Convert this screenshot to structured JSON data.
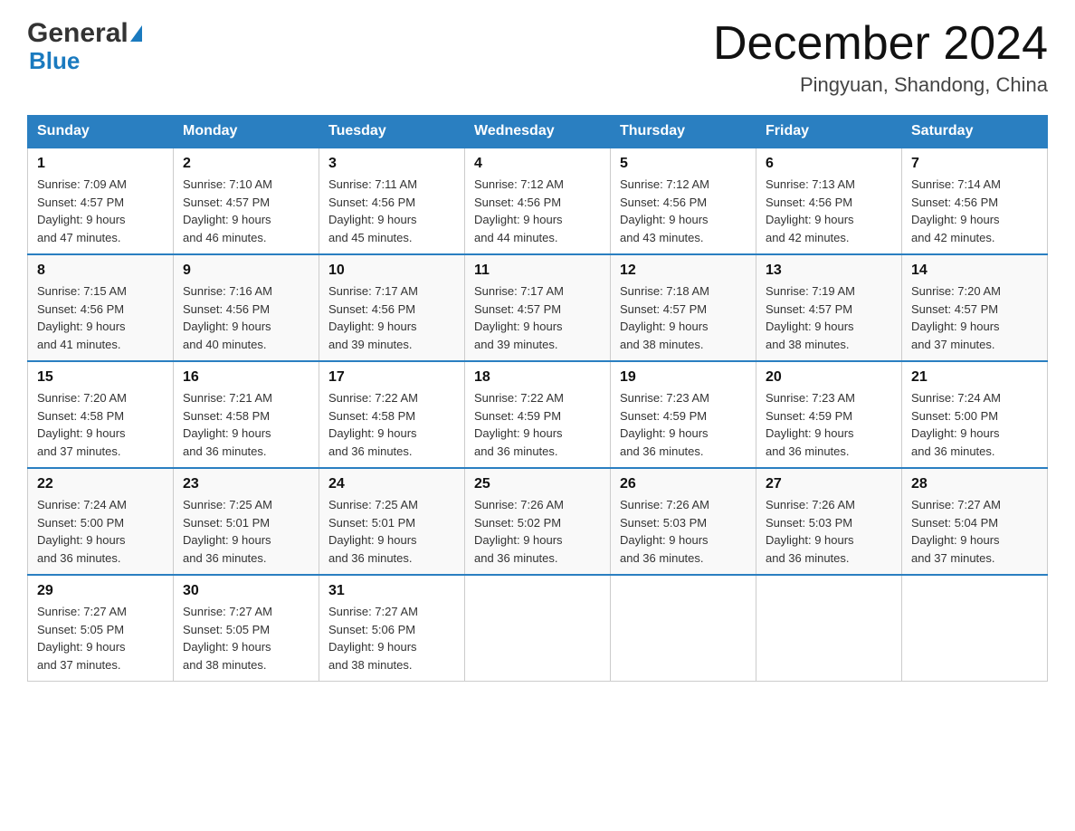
{
  "header": {
    "logo_general": "General",
    "logo_blue": "Blue",
    "month_title": "December 2024",
    "location": "Pingyuan, Shandong, China"
  },
  "days_of_week": [
    "Sunday",
    "Monday",
    "Tuesday",
    "Wednesday",
    "Thursday",
    "Friday",
    "Saturday"
  ],
  "weeks": [
    [
      {
        "day": "1",
        "sunrise": "7:09 AM",
        "sunset": "4:57 PM",
        "daylight": "9 hours and 47 minutes."
      },
      {
        "day": "2",
        "sunrise": "7:10 AM",
        "sunset": "4:57 PM",
        "daylight": "9 hours and 46 minutes."
      },
      {
        "day": "3",
        "sunrise": "7:11 AM",
        "sunset": "4:56 PM",
        "daylight": "9 hours and 45 minutes."
      },
      {
        "day": "4",
        "sunrise": "7:12 AM",
        "sunset": "4:56 PM",
        "daylight": "9 hours and 44 minutes."
      },
      {
        "day": "5",
        "sunrise": "7:12 AM",
        "sunset": "4:56 PM",
        "daylight": "9 hours and 43 minutes."
      },
      {
        "day": "6",
        "sunrise": "7:13 AM",
        "sunset": "4:56 PM",
        "daylight": "9 hours and 42 minutes."
      },
      {
        "day": "7",
        "sunrise": "7:14 AM",
        "sunset": "4:56 PM",
        "daylight": "9 hours and 42 minutes."
      }
    ],
    [
      {
        "day": "8",
        "sunrise": "7:15 AM",
        "sunset": "4:56 PM",
        "daylight": "9 hours and 41 minutes."
      },
      {
        "day": "9",
        "sunrise": "7:16 AM",
        "sunset": "4:56 PM",
        "daylight": "9 hours and 40 minutes."
      },
      {
        "day": "10",
        "sunrise": "7:17 AM",
        "sunset": "4:56 PM",
        "daylight": "9 hours and 39 minutes."
      },
      {
        "day": "11",
        "sunrise": "7:17 AM",
        "sunset": "4:57 PM",
        "daylight": "9 hours and 39 minutes."
      },
      {
        "day": "12",
        "sunrise": "7:18 AM",
        "sunset": "4:57 PM",
        "daylight": "9 hours and 38 minutes."
      },
      {
        "day": "13",
        "sunrise": "7:19 AM",
        "sunset": "4:57 PM",
        "daylight": "9 hours and 38 minutes."
      },
      {
        "day": "14",
        "sunrise": "7:20 AM",
        "sunset": "4:57 PM",
        "daylight": "9 hours and 37 minutes."
      }
    ],
    [
      {
        "day": "15",
        "sunrise": "7:20 AM",
        "sunset": "4:58 PM",
        "daylight": "9 hours and 37 minutes."
      },
      {
        "day": "16",
        "sunrise": "7:21 AM",
        "sunset": "4:58 PM",
        "daylight": "9 hours and 36 minutes."
      },
      {
        "day": "17",
        "sunrise": "7:22 AM",
        "sunset": "4:58 PM",
        "daylight": "9 hours and 36 minutes."
      },
      {
        "day": "18",
        "sunrise": "7:22 AM",
        "sunset": "4:59 PM",
        "daylight": "9 hours and 36 minutes."
      },
      {
        "day": "19",
        "sunrise": "7:23 AM",
        "sunset": "4:59 PM",
        "daylight": "9 hours and 36 minutes."
      },
      {
        "day": "20",
        "sunrise": "7:23 AM",
        "sunset": "4:59 PM",
        "daylight": "9 hours and 36 minutes."
      },
      {
        "day": "21",
        "sunrise": "7:24 AM",
        "sunset": "5:00 PM",
        "daylight": "9 hours and 36 minutes."
      }
    ],
    [
      {
        "day": "22",
        "sunrise": "7:24 AM",
        "sunset": "5:00 PM",
        "daylight": "9 hours and 36 minutes."
      },
      {
        "day": "23",
        "sunrise": "7:25 AM",
        "sunset": "5:01 PM",
        "daylight": "9 hours and 36 minutes."
      },
      {
        "day": "24",
        "sunrise": "7:25 AM",
        "sunset": "5:01 PM",
        "daylight": "9 hours and 36 minutes."
      },
      {
        "day": "25",
        "sunrise": "7:26 AM",
        "sunset": "5:02 PM",
        "daylight": "9 hours and 36 minutes."
      },
      {
        "day": "26",
        "sunrise": "7:26 AM",
        "sunset": "5:03 PM",
        "daylight": "9 hours and 36 minutes."
      },
      {
        "day": "27",
        "sunrise": "7:26 AM",
        "sunset": "5:03 PM",
        "daylight": "9 hours and 36 minutes."
      },
      {
        "day": "28",
        "sunrise": "7:27 AM",
        "sunset": "5:04 PM",
        "daylight": "9 hours and 37 minutes."
      }
    ],
    [
      {
        "day": "29",
        "sunrise": "7:27 AM",
        "sunset": "5:05 PM",
        "daylight": "9 hours and 37 minutes."
      },
      {
        "day": "30",
        "sunrise": "7:27 AM",
        "sunset": "5:05 PM",
        "daylight": "9 hours and 38 minutes."
      },
      {
        "day": "31",
        "sunrise": "7:27 AM",
        "sunset": "5:06 PM",
        "daylight": "9 hours and 38 minutes."
      },
      null,
      null,
      null,
      null
    ]
  ],
  "labels": {
    "sunrise_prefix": "Sunrise: ",
    "sunset_prefix": "Sunset: ",
    "daylight_prefix": "Daylight: "
  }
}
